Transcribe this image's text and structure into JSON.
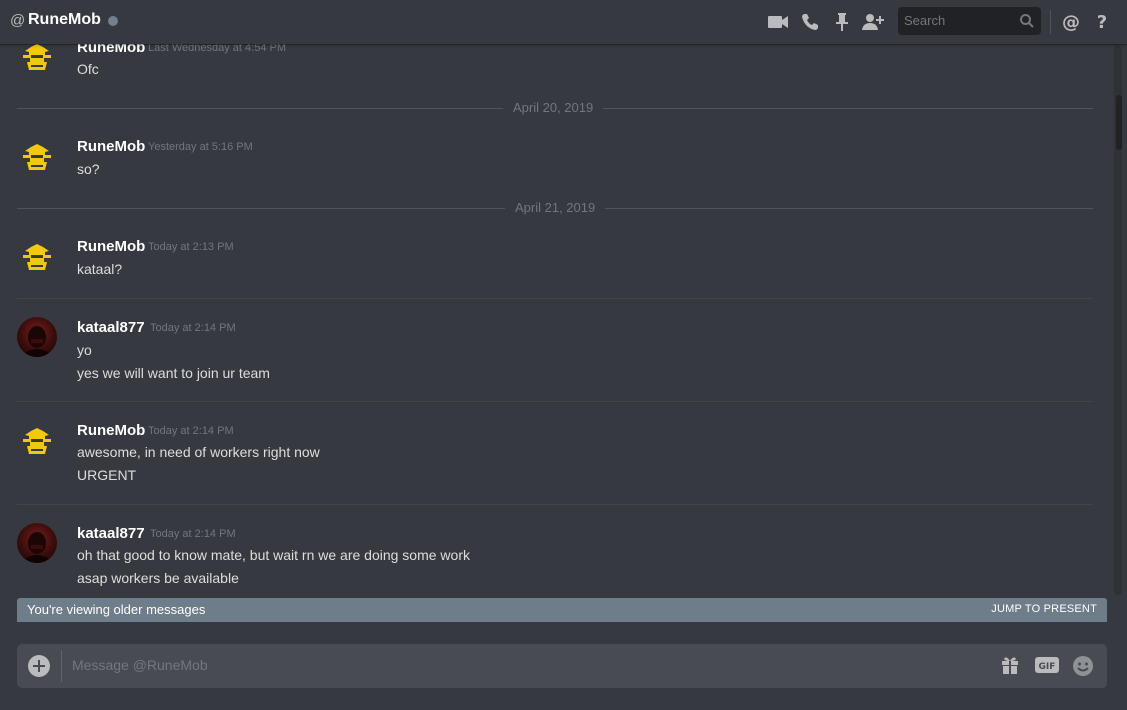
{
  "header": {
    "at_symbol": "@",
    "channel_name": "RuneMob",
    "status": "offline",
    "search_placeholder": "Search",
    "icons": [
      "video-icon",
      "phone-icon",
      "pin-icon",
      "add-friend-icon",
      "search-icon",
      "mention-icon",
      "help-icon"
    ]
  },
  "messages": [
    {
      "author": "RuneMob",
      "timestamp": "Last Wednesday at 4:54 PM",
      "lines": [
        "Ofc"
      ]
    },
    {
      "date_separator": "April 20, 2019"
    },
    {
      "author": "RuneMob",
      "timestamp": "Yesterday at 5:16 PM",
      "lines": [
        "so?"
      ]
    },
    {
      "date_separator": "April 21, 2019"
    },
    {
      "author": "RuneMob",
      "timestamp": "Today at 2:13 PM",
      "lines": [
        "kataal?"
      ]
    },
    {
      "author": "kataal877",
      "timestamp": "Today at 2:14 PM",
      "lines": [
        "yo",
        "yes we will want to join ur team"
      ]
    },
    {
      "author": "RuneMob",
      "timestamp": "Today at 2:14 PM",
      "lines": [
        "awesome, in need of workers right now",
        "URGENT"
      ]
    },
    {
      "author": "kataal877",
      "timestamp": "Today at 2:14 PM",
      "lines": [
        "oh that good to know mate, but wait rn we are doing some work",
        "asap workers be available"
      ]
    }
  ],
  "older_bar": {
    "text": "You're viewing older messages",
    "jump": "JUMP TO PRESENT"
  },
  "composer": {
    "placeholder": "Message @RuneMob",
    "icons": [
      "upload-plus-icon",
      "gift-icon",
      "gif-icon",
      "emoji-icon"
    ]
  },
  "colors": {
    "background": "#36393f",
    "header_bg": "#36393f",
    "older_bar": "#6f7c8a",
    "composer": "#484c52",
    "runemob_avatar": "#f2c811"
  }
}
